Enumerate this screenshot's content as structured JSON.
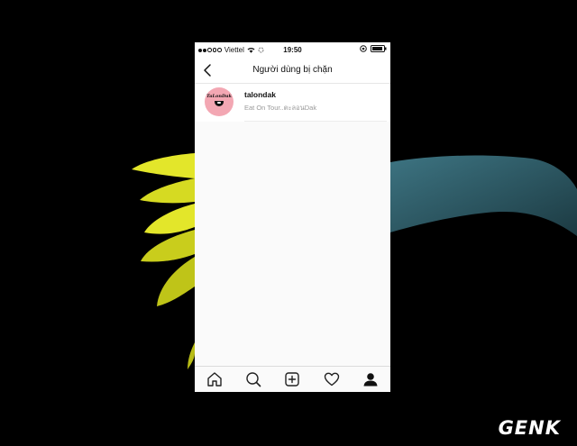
{
  "status_bar": {
    "carrier": "Viettel",
    "time": "19:50"
  },
  "nav": {
    "title": "Người dùng bị chặn"
  },
  "blocked_users": [
    {
      "username": "talondak",
      "full_name": "Eat On Tour..ตะลอนDak",
      "avatar_text": "TaLonDak"
    }
  ],
  "tabbar": {
    "items": [
      "home-icon",
      "search-icon",
      "add-post-icon",
      "heart-icon",
      "profile-icon"
    ]
  },
  "watermark": {
    "text": "GENK"
  },
  "colors": {
    "avatar_bg": "#f3a7b3",
    "flower_yellow": "#e8ea2a",
    "stem_teal": "#2f5f6a"
  }
}
